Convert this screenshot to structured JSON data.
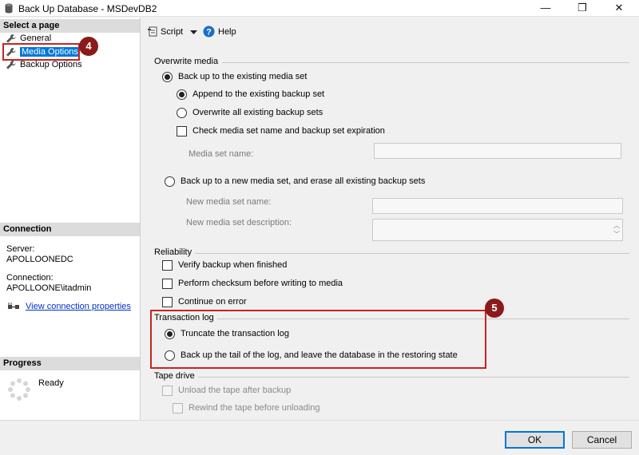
{
  "window": {
    "title": "Back Up Database - MSDevDB2",
    "minimize": "—",
    "maximize": "❐",
    "close": "✕"
  },
  "left": {
    "select_header": "Select a page",
    "pages": [
      {
        "label": "General"
      },
      {
        "label": "Media Options"
      },
      {
        "label": "Backup Options"
      }
    ],
    "connection_header": "Connection",
    "server_label": "Server:",
    "server_value": "APOLLOONEDC",
    "connection_label": "Connection:",
    "connection_value": "APOLLOONE\\itadmin",
    "view_props": "View connection properties",
    "progress_header": "Progress",
    "progress_status": "Ready"
  },
  "badges": {
    "first": "4",
    "second": "5"
  },
  "toolbar": {
    "script": "Script",
    "help": "Help"
  },
  "overwrite": {
    "title": "Overwrite media",
    "existing": "Back up to the existing media set",
    "append": "Append to the existing backup set",
    "overwrite_all": "Overwrite all existing backup sets",
    "check_name": "Check media set name and backup set expiration",
    "media_name_label": "Media set name:",
    "media_name_value": "",
    "new_set": "Back up to a new media set, and erase all existing backup sets",
    "new_name_label": "New media set name:",
    "new_name_value": "",
    "new_desc_label": "New media set description:",
    "new_desc_value": ""
  },
  "reliability": {
    "title": "Reliability",
    "verify": "Verify backup when finished",
    "checksum": "Perform checksum before writing to media",
    "continue": "Continue on error"
  },
  "tlog": {
    "title": "Transaction log",
    "truncate": "Truncate the transaction log",
    "tail": "Back up the tail of the log, and leave the database in the restoring state"
  },
  "tape": {
    "title": "Tape drive",
    "unload": "Unload the tape after backup",
    "rewind": "Rewind the tape before unloading"
  },
  "footer": {
    "ok": "OK",
    "cancel": "Cancel"
  },
  "colors": {
    "accent": "#0078d7",
    "highlight_red": "#cc2222",
    "badge": "#8b1a1a"
  }
}
